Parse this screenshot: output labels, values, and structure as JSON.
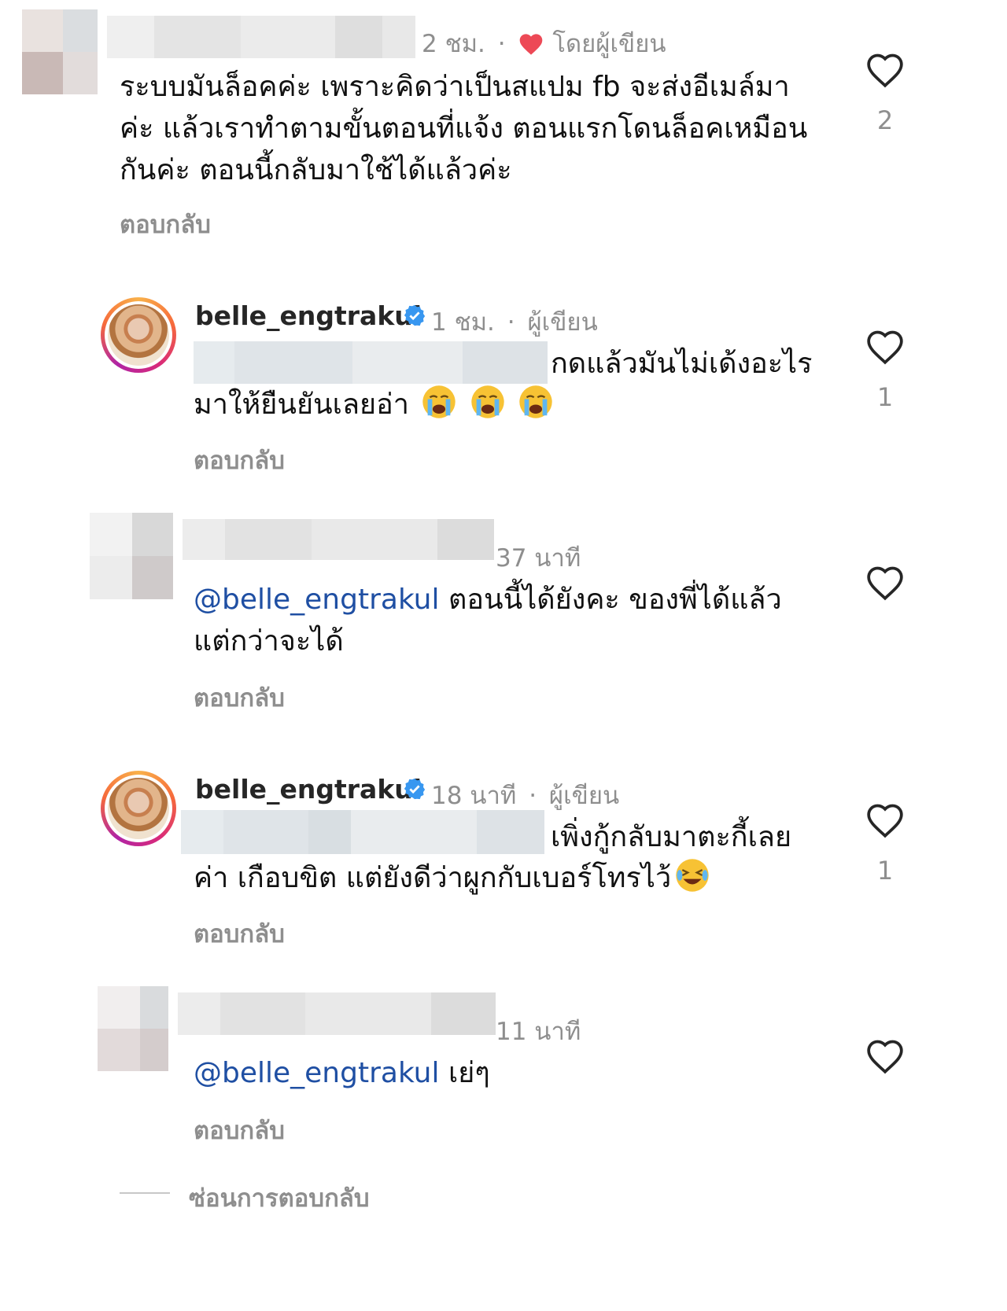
{
  "comments": [
    {
      "time": "2 ชม.",
      "liked_by_author_label": "โดยผู้เขียน",
      "text_lines": [
        "ระบบมันล็อคค่ะ เพราะคิดว่าเป็นสแปม fb จะส่งอีเมล์มา",
        "ค่ะ แล้วเราทำตามขั้นตอนที่แจ้ง ตอนแรกโดนล็อคเหมือน",
        "กันค่ะ ตอนนี้กลับมาใช้ได้แล้วค่ะ"
      ],
      "reply_label": "ตอบกลับ",
      "like_count": "2"
    },
    {
      "username": "belle_engtrakul",
      "time": "1 ชม.",
      "author_label": "ผู้เขียน",
      "text_lines": [
        "กดแล้วมันไม่เด้งอะไร",
        "มาให้ยืนยันเลยอ่า"
      ],
      "emoji": "crying-face-emoji",
      "reply_label": "ตอบกลับ",
      "like_count": "1"
    },
    {
      "time": "37 นาที",
      "mention": "@belle_engtrakul",
      "text_lines": [
        "ตอนนี้ได้ยังคะ ของพี่ได้แล้ว",
        "แต่กว่าจะได้"
      ],
      "reply_label": "ตอบกลับ"
    },
    {
      "username": "belle_engtrakul",
      "time": "18 นาที",
      "author_label": "ผู้เขียน",
      "text_lines": [
        "เพิ่งกู้กลับมาตะกี้เลย",
        "ค่า เกือบขิต แต่ยังดีว่าผูกกับเบอร์โทรไว้"
      ],
      "emoji": "laughing-tears-emoji",
      "reply_label": "ตอบกลับ",
      "like_count": "1"
    },
    {
      "time": "11 นาที",
      "mention": "@belle_engtrakul",
      "text_lines": [
        "เย่ๆ"
      ],
      "reply_label": "ตอบกลับ"
    }
  ],
  "hide_replies_label": "ซ่อนการตอบกลับ",
  "colors": {
    "heart_red": "#ed4956",
    "mention_blue": "#1f4fa3",
    "verified_blue": "#3897f0",
    "muted_gray": "#8e8e8e"
  }
}
